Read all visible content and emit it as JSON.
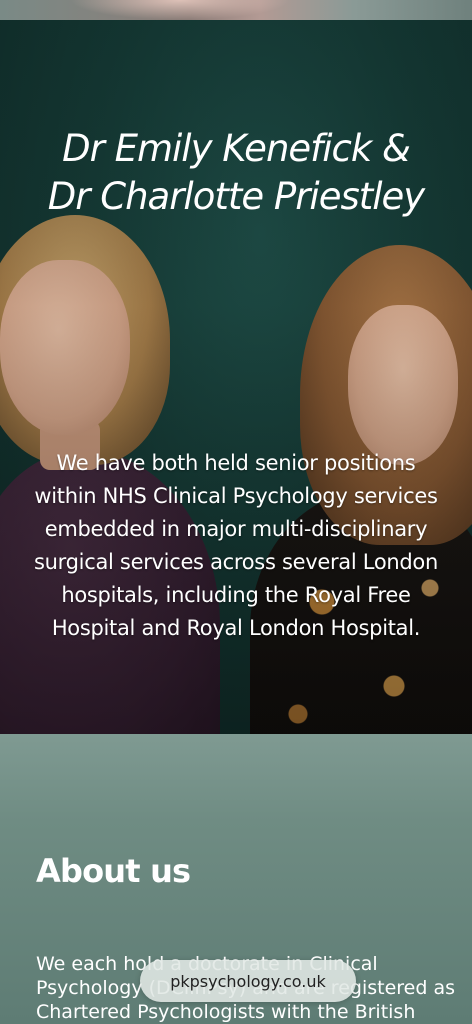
{
  "hero": {
    "title_line1": "Dr Emily Kenefick &",
    "title_line2": "Dr Charlotte Priestley",
    "description": "We have both held senior positions within NHS Clinical Psychology services embedded in major multi-disciplinary surgical services across several London hospitals, including the Royal Free Hospital and Royal London Hospital."
  },
  "about": {
    "heading": "About us",
    "text_line1": "We each hold a doctorate in Clinical",
    "text_line2": "Psychology (DClinPsy) and are registered as",
    "text_line3": "Chartered Psychologists with the British"
  },
  "browser": {
    "url": "pkpsychology.co.uk"
  }
}
